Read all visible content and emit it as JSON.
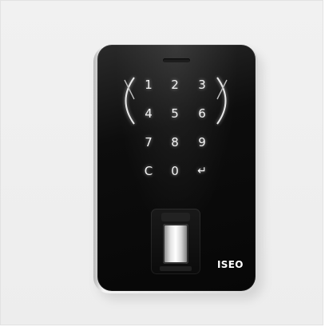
{
  "keypad": {
    "keys": [
      "1",
      "2",
      "3",
      "4",
      "5",
      "6",
      "7",
      "8",
      "9",
      "C",
      "0",
      "↵"
    ]
  },
  "brand": {
    "logo": "ISEO"
  },
  "colors": {
    "background": "#efefef",
    "device_face": "#0a0a0a",
    "key_glow": "#f3f3f3",
    "edge": "#e6e6e6"
  },
  "icons": {
    "enter": "enter-arrow-icon",
    "left_indicator": "left-arc-icon",
    "right_indicator": "right-arc-icon",
    "reader": "fingerprint-reader-icon"
  }
}
